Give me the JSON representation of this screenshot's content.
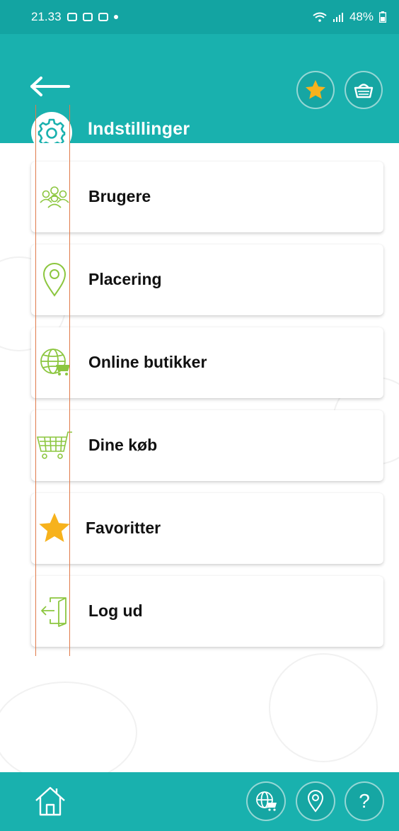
{
  "status_bar": {
    "time": "21.33",
    "battery": "48%"
  },
  "header": {
    "title": "Indstillinger"
  },
  "menu": {
    "items": [
      {
        "label": "Brugere",
        "icon": "users-icon"
      },
      {
        "label": "Placering",
        "icon": "location-pin-icon"
      },
      {
        "label": "Online butikker",
        "icon": "globe-cart-icon"
      },
      {
        "label": "Dine køb",
        "icon": "shopping-cart-icon"
      },
      {
        "label": "Favoritter",
        "icon": "star-icon"
      },
      {
        "label": "Log ud",
        "icon": "logout-door-icon"
      }
    ]
  },
  "bottom_nav": {
    "help_label": "?"
  },
  "colors": {
    "teal": "#19b1ae",
    "teal_dark": "#13a4a2",
    "green_icon": "#8cc63f",
    "star_gold": "#f7b21c"
  }
}
